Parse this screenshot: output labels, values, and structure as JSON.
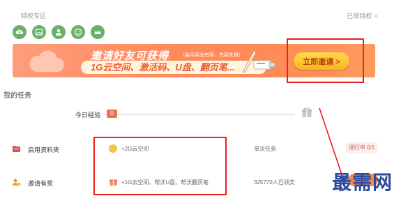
{
  "header": {
    "section_label": "特权专区",
    "right_link": "已领特权 >"
  },
  "icons": [
    "cloud-upload-icon",
    "image-icon",
    "user-icon",
    "smile-icon",
    "crown-icon"
  ],
  "banner": {
    "title": "邀请好友可获得",
    "subtitle": "（每月奖品有限，先到先得）",
    "rewards_text": "1G云空间、激活码、U盘、翻页笔...",
    "cta_label": "立即邀请 >"
  },
  "tasks": {
    "section_title": "我的任务",
    "today_exp_label": "今日经验",
    "today_exp_value": "0",
    "rows": [
      {
        "name": "启用资料夹",
        "reward": "+2G云空间",
        "type": "单次任务",
        "status": "进行中 0/1"
      },
      {
        "name": "邀请有奖",
        "reward": "+1G云空间、帮沃U盘、帮沃翻页笔",
        "count": "325770人已领奖"
      }
    ]
  },
  "watermark": "最需网",
  "colors": {
    "accent": "#ff8a55",
    "red_annotation": "#e8201e",
    "icon_green": "#6ab06b"
  }
}
